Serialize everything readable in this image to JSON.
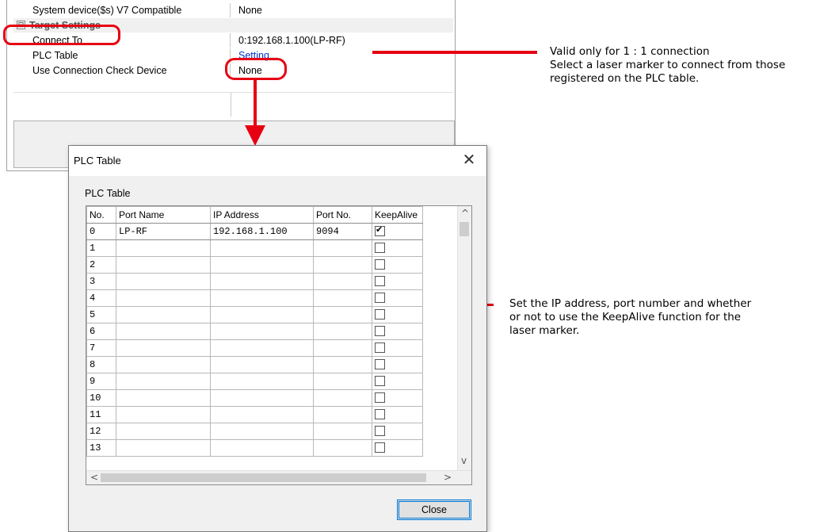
{
  "properties": {
    "rows": [
      {
        "label": "System device($s) V7 Compatible",
        "value": "None"
      },
      {
        "group": "Target Settings",
        "collapse_symbol": "⊟"
      },
      {
        "label": "Connect To",
        "value": "0:192.168.1.100(LP-RF)"
      },
      {
        "label": "PLC Table",
        "value": "Setting..."
      },
      {
        "label": "Use Connection Check Device",
        "value": "None"
      }
    ]
  },
  "annotations": {
    "connect_note": [
      "Valid only for 1 : 1 connection",
      "Select a laser marker to connect from those",
      "registered on the PLC table."
    ],
    "table_note": [
      "Set the IP address, port number and whether",
      "or not to use the KeepAlive function for the",
      "laser marker."
    ],
    "accent_color": "#e60012"
  },
  "dialog": {
    "title": "PLC Table",
    "close_glyph": "✕",
    "group_label": "PLC Table",
    "columns": [
      "No.",
      "Port Name",
      "IP Address",
      "Port No.",
      "KeepAlive"
    ],
    "rows": [
      {
        "no": "0",
        "port_name": "LP-RF",
        "ip": "192.168.1.100",
        "port": "9094",
        "keepalive": true
      },
      {
        "no": "1",
        "port_name": "",
        "ip": "",
        "port": "",
        "keepalive": false
      },
      {
        "no": "2",
        "port_name": "",
        "ip": "",
        "port": "",
        "keepalive": false
      },
      {
        "no": "3",
        "port_name": "",
        "ip": "",
        "port": "",
        "keepalive": false
      },
      {
        "no": "4",
        "port_name": "",
        "ip": "",
        "port": "",
        "keepalive": false
      },
      {
        "no": "5",
        "port_name": "",
        "ip": "",
        "port": "",
        "keepalive": false
      },
      {
        "no": "6",
        "port_name": "",
        "ip": "",
        "port": "",
        "keepalive": false
      },
      {
        "no": "7",
        "port_name": "",
        "ip": "",
        "port": "",
        "keepalive": false
      },
      {
        "no": "8",
        "port_name": "",
        "ip": "",
        "port": "",
        "keepalive": false
      },
      {
        "no": "9",
        "port_name": "",
        "ip": "",
        "port": "",
        "keepalive": false
      },
      {
        "no": "10",
        "port_name": "",
        "ip": "",
        "port": "",
        "keepalive": false
      },
      {
        "no": "11",
        "port_name": "",
        "ip": "",
        "port": "",
        "keepalive": false
      },
      {
        "no": "12",
        "port_name": "",
        "ip": "",
        "port": "",
        "keepalive": false
      },
      {
        "no": "13",
        "port_name": "",
        "ip": "",
        "port": "",
        "keepalive": false
      }
    ],
    "close_label": "Close",
    "scroll_up": "^",
    "scroll_down": "v",
    "scroll_left": "<",
    "scroll_right": ">"
  }
}
